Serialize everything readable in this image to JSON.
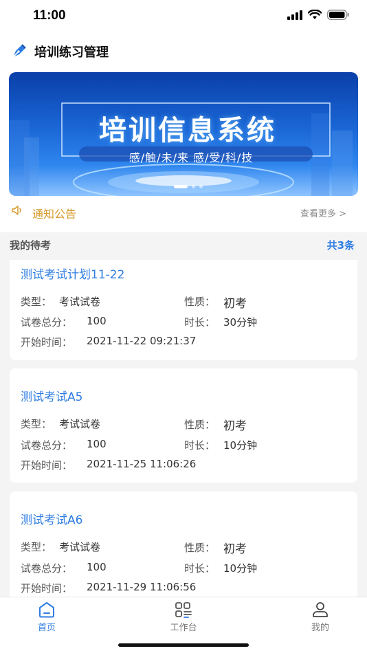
{
  "status_bar": {
    "time": "11:00"
  },
  "header": {
    "title": "培训练习管理"
  },
  "banner": {
    "title": "培训信息系统",
    "subtitle": "感/触/未/来    感/受/科/技"
  },
  "notice": {
    "label": "通知公告",
    "more": "查看更多 >"
  },
  "exams": {
    "heading": "我的待考",
    "count": "共3条",
    "labels": {
      "type": "类型：",
      "nature": "性质：",
      "total": "试卷总分：",
      "duration": "时长：",
      "start": "开始时间："
    },
    "items": [
      {
        "title": "测试考试计划11-22",
        "type": "考试试卷",
        "nature": "初考",
        "total": "100",
        "duration": "30分钟",
        "start": "2021-11-22 09:21:37"
      },
      {
        "title": "测试考试A5",
        "type": "考试试卷",
        "nature": "初考",
        "total": "100",
        "duration": "10分钟",
        "start": "2021-11-25 11:06:26"
      },
      {
        "title": "测试考试A6",
        "type": "考试试卷",
        "nature": "初考",
        "total": "100",
        "duration": "10分钟",
        "start": "2021-11-29 11:06:56"
      }
    ]
  },
  "tabbar": {
    "items": [
      {
        "label": "首页",
        "icon": "home-icon",
        "active": true
      },
      {
        "label": "工作台",
        "icon": "grid-icon",
        "active": false
      },
      {
        "label": "我的",
        "icon": "person-icon",
        "active": false
      }
    ],
    "active_color": "#2f7de1",
    "inactive_color": "#777777"
  }
}
